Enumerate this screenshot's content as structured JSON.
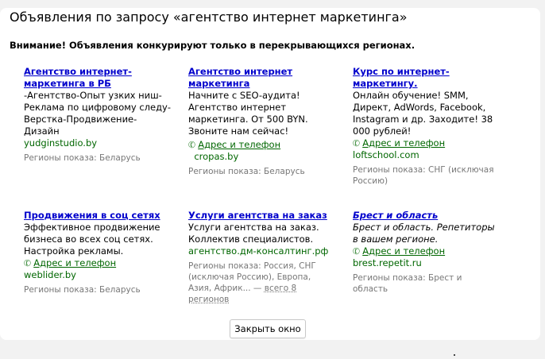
{
  "dialog": {
    "title": "Объявления по запросу «агентство интернет маркетинга»",
    "notice": "Внимание! Объявления конкурируют только в перекрывающихся регионах.",
    "close_label": "Закрыть окно"
  },
  "phone_label": "Адрес и телефон",
  "ads": [
    {
      "title": "Агентство интернет-маркетинга в РБ",
      "text": "-Агентство-Опыт узких ниш-Реклама по цифровому следу-Верстка-Продвижение-Дизайн",
      "url": "yudginstudio.by",
      "regions": "Регионы показа: Беларусь"
    },
    {
      "title": "Агентство интернет маркетинга",
      "text": "Начните с SEO-аудита! Агентство интернет маркетинга. От 500 BYN. Звоните нам сейчас!",
      "url": "cropas.by",
      "regions": "Регионы показа: Беларусь"
    },
    {
      "title": "Курс по интернет-маркетингу.",
      "text": "Онлайн обучение! SMM, Директ, AdWords, Facebook, Instagram и др. Заходите! 38 000 рублей!",
      "url": "loftschool.com",
      "regions": "Регионы показа: СНГ (исключая Россию)"
    },
    {
      "title": "Продвижения в соц сетях",
      "text": "Эффективное продвижение бизнеса во всех соц сетях. Настройка рекламы.",
      "url": "weblider.by",
      "regions": "Регионы показа: Беларусь"
    },
    {
      "title": "Услуги агентства на заказ",
      "text": "Услуги агентства на заказ. Коллектив специалистов.",
      "url": "агентство.дм-консалтинг.рф",
      "regions": "Регионы показа: Россия, СНГ (исключая Россию), Европа, Азия, Африк... —",
      "more": "всего 8 регионов"
    },
    {
      "title": "Брест и область",
      "text": "Брест и область. Репетиторы в вашем регионе.",
      "url": "brest.repetit.ru",
      "regions": "Регионы показа: Брест и область"
    }
  ]
}
